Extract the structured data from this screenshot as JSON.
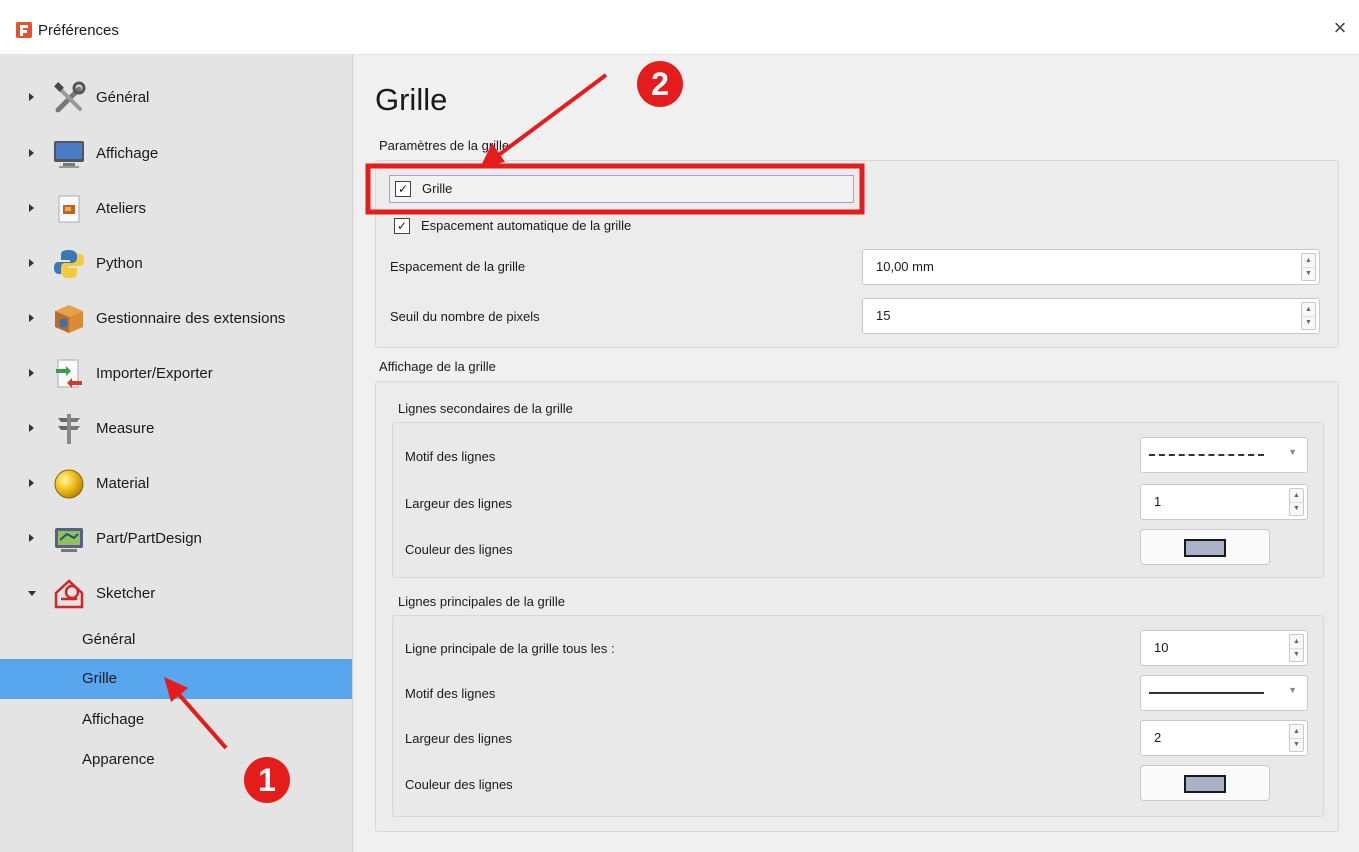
{
  "window": {
    "title": "Préférences",
    "close_icon": "close-icon",
    "accent": "#58a7ee"
  },
  "sidebar": {
    "items": [
      {
        "label": "Général",
        "icon": "tools-icon",
        "expanded": false
      },
      {
        "label": "Affichage",
        "icon": "monitor-icon",
        "expanded": false
      },
      {
        "label": "Ateliers",
        "icon": "workbench-icon",
        "expanded": false
      },
      {
        "label": "Python",
        "icon": "python-icon",
        "expanded": false
      },
      {
        "label": "Gestionnaire des extensions",
        "icon": "package-icon",
        "expanded": false
      },
      {
        "label": "Importer/Exporter",
        "icon": "import-export-icon",
        "expanded": false
      },
      {
        "label": "Measure",
        "icon": "caliper-icon",
        "expanded": false
      },
      {
        "label": "Material",
        "icon": "sphere-icon",
        "expanded": false
      },
      {
        "label": "Part/PartDesign",
        "icon": "part-icon",
        "expanded": false
      },
      {
        "label": "Sketcher",
        "icon": "sketcher-icon",
        "expanded": true
      }
    ],
    "sub_items": [
      {
        "label": "Général",
        "selected": false
      },
      {
        "label": "Grille",
        "selected": true
      },
      {
        "label": "Affichage",
        "selected": false
      },
      {
        "label": "Apparence",
        "selected": false
      }
    ]
  },
  "main": {
    "title": "Grille",
    "grid_params": {
      "title": "Paramètres de la grille",
      "grid_checkbox": {
        "label": "Grille",
        "checked": true
      },
      "auto_spacing_checkbox": {
        "label": "Espacement automatique de la grille",
        "checked": true
      },
      "spacing": {
        "label": "Espacement de la grille",
        "value": "10,00 mm"
      },
      "pixel_threshold": {
        "label": "Seuil du nombre de pixels",
        "value": "15"
      }
    },
    "grid_display": {
      "title": "Affichage de la grille",
      "minor": {
        "title": "Lignes secondaires de la grille",
        "pattern_label": "Motif des lignes",
        "pattern_value": "dashed",
        "width_label": "Largeur des lignes",
        "width_value": "1",
        "color_label": "Couleur des lignes",
        "color_value": "#a9b2c6"
      },
      "major": {
        "title": "Lignes principales de la grille",
        "every_label": "Ligne principale de la grille tous les :",
        "every_value": "10",
        "pattern_label": "Motif des lignes",
        "pattern_value": "solid",
        "width_label": "Largeur des lignes",
        "width_value": "2",
        "color_label": "Couleur des lignes",
        "color_value": "#a9b2c6"
      }
    }
  },
  "annotations": {
    "badge_1": "1",
    "badge_2": "2",
    "color": "#e41c1c"
  }
}
